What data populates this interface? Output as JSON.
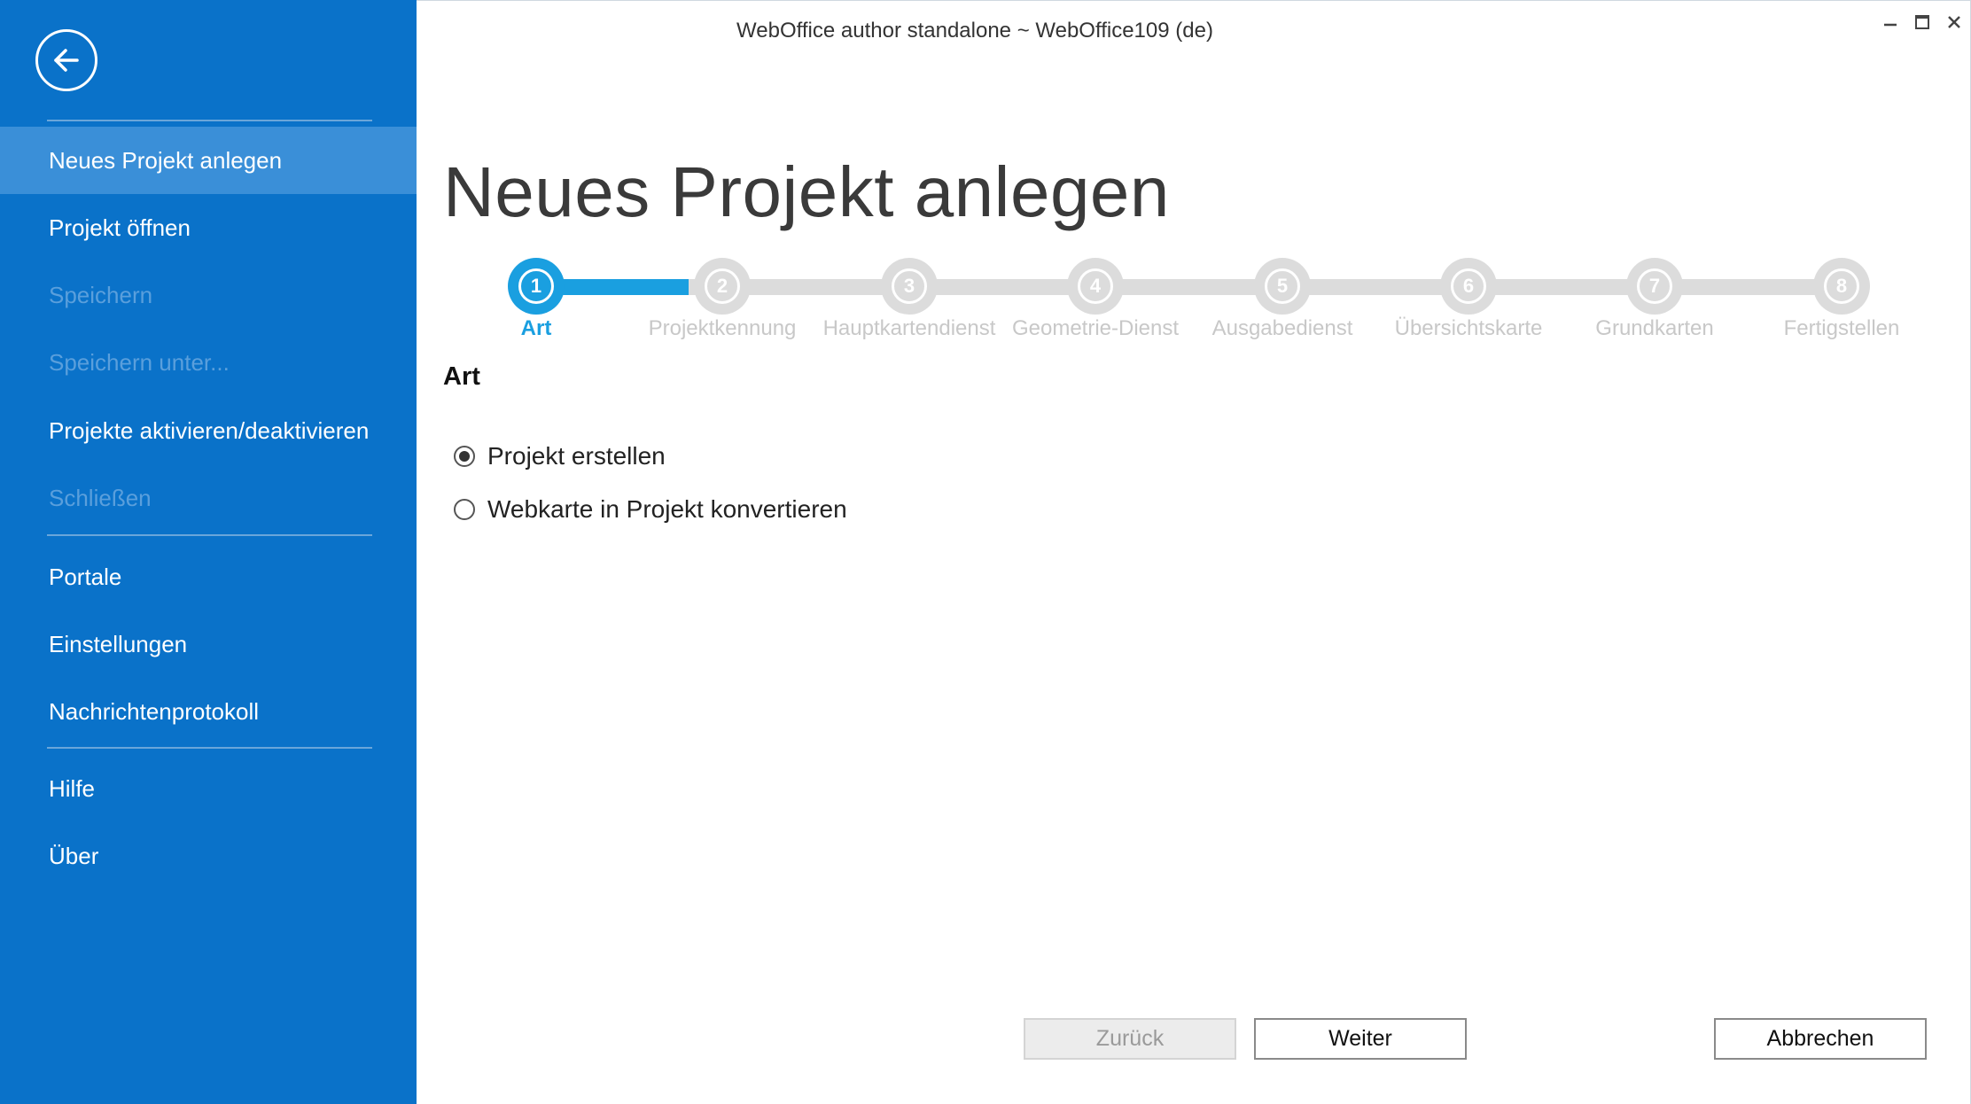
{
  "window": {
    "title": "WebOffice author standalone ~ WebOffice109 (de)",
    "controls": [
      "minimize-icon",
      "maximize-icon",
      "close-icon"
    ]
  },
  "sidebar": {
    "back_icon": "arrow-left-circle-icon",
    "items": [
      {
        "label": "Neues Projekt anlegen",
        "state": "active"
      },
      {
        "label": "Projekt öffnen",
        "state": "enabled"
      },
      {
        "label": "Speichern",
        "state": "disabled"
      },
      {
        "label": "Speichern unter...",
        "state": "disabled"
      },
      {
        "label": "Projekte aktivieren/deaktivieren",
        "state": "enabled"
      },
      {
        "label": "Schließen",
        "state": "disabled"
      },
      {
        "label": "Portale",
        "state": "enabled"
      },
      {
        "label": "Einstellungen",
        "state": "enabled"
      },
      {
        "label": "Nachrichtenprotokoll",
        "state": "enabled"
      },
      {
        "label": "Hilfe",
        "state": "enabled"
      },
      {
        "label": "Über",
        "state": "enabled"
      }
    ]
  },
  "main": {
    "page_title": "Neues Projekt anlegen",
    "stepper": {
      "current_step": 1,
      "steps": [
        {
          "number": "1",
          "label": "Art"
        },
        {
          "number": "2",
          "label": "Projektkennung"
        },
        {
          "number": "3",
          "label": "Hauptkartendienst"
        },
        {
          "number": "4",
          "label": "Geometrie-Dienst"
        },
        {
          "number": "5",
          "label": "Ausgabedienst"
        },
        {
          "number": "6",
          "label": "Übersichtskarte"
        },
        {
          "number": "7",
          "label": "Grundkarten"
        },
        {
          "number": "8",
          "label": "Fertigstellen"
        }
      ]
    },
    "section_heading": "Art",
    "options": [
      {
        "label": "Projekt erstellen",
        "selected": true
      },
      {
        "label": "Webkarte in Projekt konvertieren",
        "selected": false
      }
    ],
    "buttons": {
      "back": {
        "label": "Zurück",
        "enabled": false
      },
      "next": {
        "label": "Weiter",
        "enabled": true
      },
      "cancel": {
        "label": "Abbrechen",
        "enabled": true
      }
    }
  },
  "colors": {
    "sidebar_bg": "#0a72c9",
    "sidebar_active": "#3a8fd8",
    "accent": "#1a9fe0",
    "step_inactive": "#dcdcdc"
  }
}
